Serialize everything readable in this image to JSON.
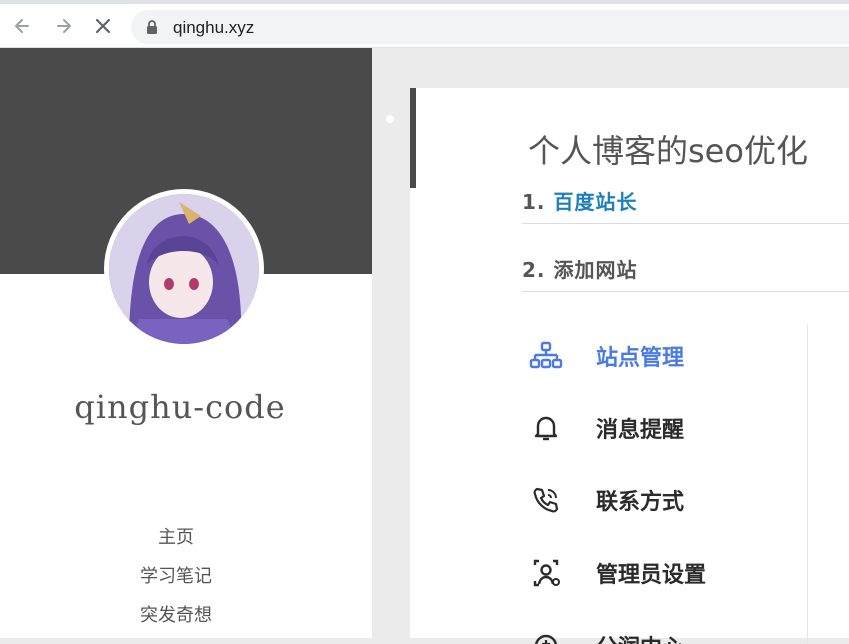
{
  "browser": {
    "url": "qinghu.xyz",
    "icons": [
      "back-icon",
      "forward-icon",
      "stop-loading-icon",
      "lock-icon"
    ]
  },
  "sidebar": {
    "author": "qinghu-code",
    "menu": [
      {
        "label": "主页"
      },
      {
        "label": "学习笔记"
      },
      {
        "label": "突发奇想"
      }
    ]
  },
  "article": {
    "title": "个人博客的seo优化",
    "sections": [
      {
        "number": "1.",
        "label": "百度站长",
        "is_link": true
      },
      {
        "number": "2.",
        "label": "添加网站",
        "is_link": false
      }
    ],
    "embedded_menu": [
      {
        "label": "站点管理",
        "icon": "site-management-icon",
        "active": true
      },
      {
        "label": "消息提醒",
        "icon": "bell-icon",
        "active": false
      },
      {
        "label": "联系方式",
        "icon": "phone-icon",
        "active": false
      },
      {
        "label": "管理员设置",
        "icon": "admin-settings-icon",
        "active": false
      },
      {
        "label": "分润中心",
        "icon": "center-icon",
        "active": false
      }
    ]
  },
  "colors": {
    "cover": "#4a4a4a",
    "link": "#1e7fbf",
    "active_menu": "#4a7ae6"
  }
}
